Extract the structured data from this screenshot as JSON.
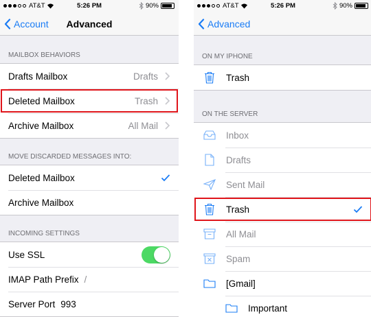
{
  "colors": {
    "accent": "#1a7cf5",
    "toggle_on": "#4cd964",
    "highlight": "#e0141a",
    "muted": "#8e8e93"
  },
  "left": {
    "status": {
      "carrier": "AT&T",
      "time": "5:26 PM",
      "battery": "90%",
      "battery_level": 0.9
    },
    "nav": {
      "back": "Account",
      "title": "Advanced"
    },
    "mailbox_behaviors": {
      "header": "MAILBOX BEHAVIORS",
      "rows": [
        {
          "label": "Drafts Mailbox",
          "value": "Drafts"
        },
        {
          "label": "Deleted Mailbox",
          "value": "Trash"
        },
        {
          "label": "Archive Mailbox",
          "value": "All Mail"
        }
      ]
    },
    "discarded": {
      "header": "MOVE DISCARDED MESSAGES INTO:",
      "rows": [
        {
          "label": "Deleted Mailbox",
          "selected": true
        },
        {
          "label": "Archive Mailbox",
          "selected": false
        }
      ]
    },
    "incoming": {
      "header": "INCOMING SETTINGS",
      "use_ssl": {
        "label": "Use SSL",
        "on": true
      },
      "imap_prefix": {
        "label": "IMAP Path Prefix",
        "value": "/"
      },
      "server_port": {
        "label": "Server Port",
        "value": "993"
      }
    }
  },
  "right": {
    "status": {
      "carrier": "AT&T",
      "time": "5:26 PM",
      "battery": "90%",
      "battery_level": 0.9
    },
    "nav": {
      "back": "Advanced"
    },
    "on_phone": {
      "header": "ON MY IPHONE",
      "rows": [
        {
          "label": "Trash",
          "icon": "trash-icon"
        }
      ]
    },
    "on_server": {
      "header": "ON THE SERVER",
      "rows": [
        {
          "label": "Inbox",
          "icon": "inbox-icon"
        },
        {
          "label": "Drafts",
          "icon": "document-icon"
        },
        {
          "label": "Sent Mail",
          "icon": "paper-plane-icon"
        },
        {
          "label": "Trash",
          "icon": "trash-icon",
          "selected": true
        },
        {
          "label": "All Mail",
          "icon": "archive-box-icon"
        },
        {
          "label": "Spam",
          "icon": "junk-box-icon"
        },
        {
          "label": "[Gmail]",
          "icon": "folder-icon"
        },
        {
          "label": "Important",
          "icon": "folder-icon"
        }
      ]
    }
  }
}
